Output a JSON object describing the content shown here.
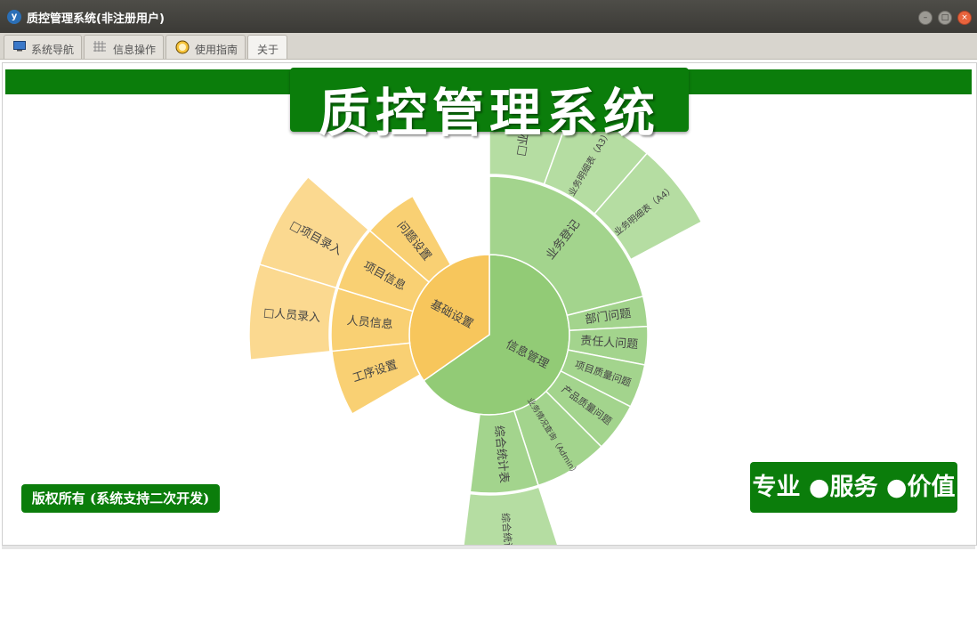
{
  "window": {
    "title": "质控管理系统(非注册用户)"
  },
  "tabs": [
    {
      "label": "系统导航",
      "icon": "monitor-icon"
    },
    {
      "label": "信息操作",
      "icon": "grid-icon"
    },
    {
      "label": "使用指南",
      "icon": "clock-icon"
    },
    {
      "label": "关于",
      "icon": ""
    }
  ],
  "banner": {
    "title": "质控管理系统"
  },
  "footer": {
    "copyright": "版权所有 (系统支持二次开发)",
    "slogan": "专业 ●服务 ●价值"
  },
  "colors": {
    "brand_green": "#0b7d0b",
    "orange": "#f7c65c",
    "green": "#92cb76"
  },
  "sunburst": {
    "center_label_a": "信息管理",
    "center_label_b": "基础设置",
    "ring2_green": [
      "业务登记",
      "部门问题",
      "责任人问题",
      "项目质量问题",
      "产品质量问题",
      "业务情况查询（Admin）",
      "综合统计表"
    ],
    "ring2_orange": [
      "问题设置",
      "项目信息",
      "人员信息",
      "工序设置"
    ],
    "ring3_green": [
      "□业务",
      "业务明细表（A3）",
      "业务明细表（A4）",
      "综合统计"
    ],
    "ring3_orange": [
      "□项目录入",
      "□人员录入"
    ]
  }
}
